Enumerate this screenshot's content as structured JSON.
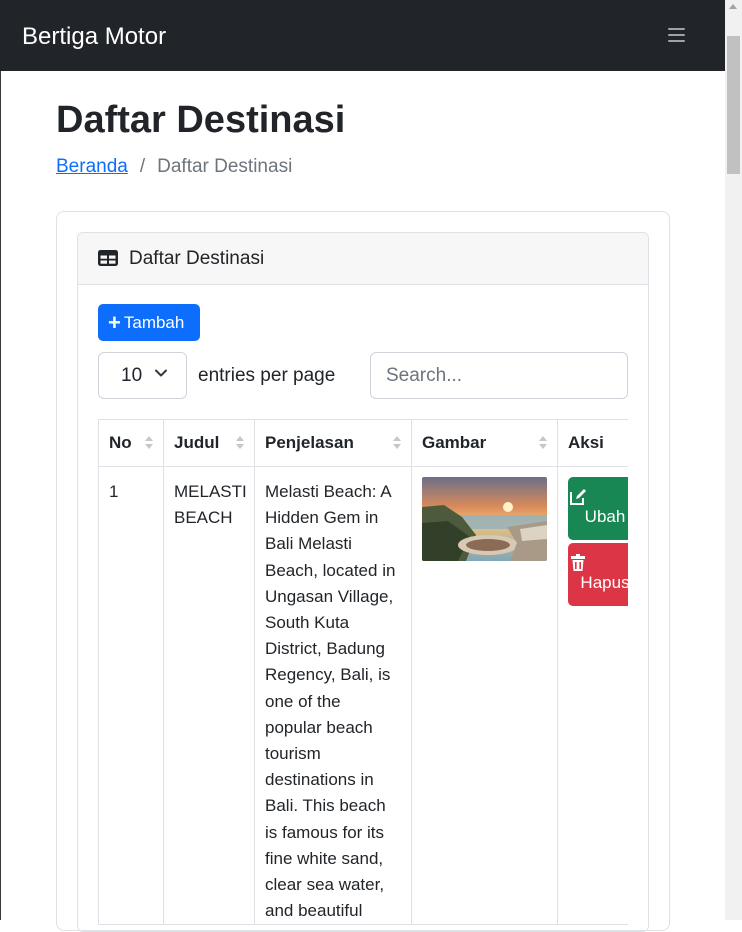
{
  "navbar": {
    "brand": "Bertiga Motor",
    "menu_icon": "hamburger-icon"
  },
  "page": {
    "title": "Daftar Destinasi"
  },
  "breadcrumb": {
    "home": "Beranda",
    "separator": "/",
    "current": "Daftar Destinasi"
  },
  "card": {
    "title": "Daftar Destinasi",
    "icon": "table-icon"
  },
  "toolbar": {
    "add_label": "Tambah"
  },
  "datatable": {
    "per_page_value": "10",
    "per_page_label": "entries per page",
    "search_placeholder": "Search..."
  },
  "table": {
    "headers": [
      "No",
      "Judul",
      "Penjelasan",
      "Gambar",
      "Aksi"
    ],
    "rows": [
      {
        "no": "1",
        "judul": "MELASTI BEACH",
        "penjelasan": "Melasti Beach: A Hidden Gem in Bali Melasti Beach, located in Ungasan Village, South Kuta District, Badung Regency, Bali, is one of the popular beach tourism destinations in Bali. This beach is famous for its fine white sand, clear sea water, and beautiful",
        "edit_label": "Ubah",
        "delete_label": "Hapus"
      }
    ]
  },
  "colors": {
    "navbar_bg": "#212529",
    "primary": "#0d6efd",
    "success": "#198754",
    "danger": "#dc3545"
  }
}
